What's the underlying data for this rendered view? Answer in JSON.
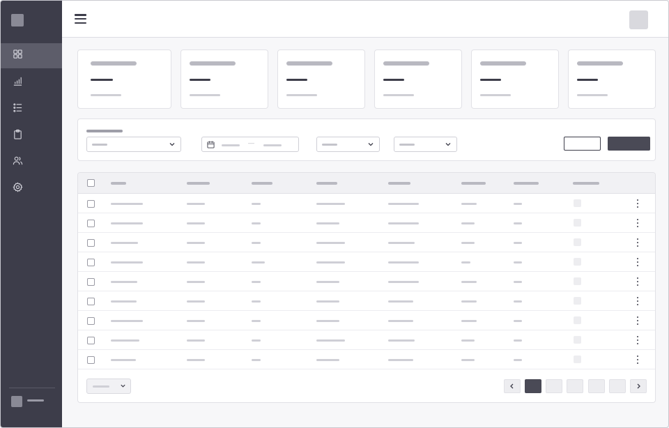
{
  "sidebar": {
    "logo": "app-logo",
    "items": [
      {
        "name": "dashboard",
        "icon": "grid-icon",
        "active": true
      },
      {
        "name": "analytics",
        "icon": "bar-chart-icon",
        "active": false
      },
      {
        "name": "list",
        "icon": "list-icon",
        "active": false
      },
      {
        "name": "clipboard",
        "icon": "clipboard-icon",
        "active": false
      },
      {
        "name": "users",
        "icon": "users-icon",
        "active": false
      },
      {
        "name": "settings",
        "icon": "gear-icon",
        "active": false
      }
    ],
    "user": {
      "icon": "avatar"
    }
  },
  "header": {
    "menu_icon": "hamburger-icon",
    "avatar": "user-avatar"
  },
  "stat_cards": 6,
  "filters": {
    "fields": [
      "select",
      "date-range",
      "select",
      "select"
    ],
    "date_separator": "—",
    "icons": {
      "calendar": "calendar-icon",
      "chevron": "chevron-down-icon"
    }
  },
  "table": {
    "columns": 8,
    "rows": 9,
    "row_actions_icon": "more-vertical-icon"
  },
  "pagination": {
    "pages": 5,
    "current": 1,
    "prev_icon": "chevron-left-icon",
    "next_icon": "chevron-right-icon"
  },
  "colors": {
    "sidebar": "#3d3d4a",
    "sidebar_active": "#5d5d6a",
    "primary_button": "#4a4a56",
    "page_bg": "#f7f7f9"
  }
}
